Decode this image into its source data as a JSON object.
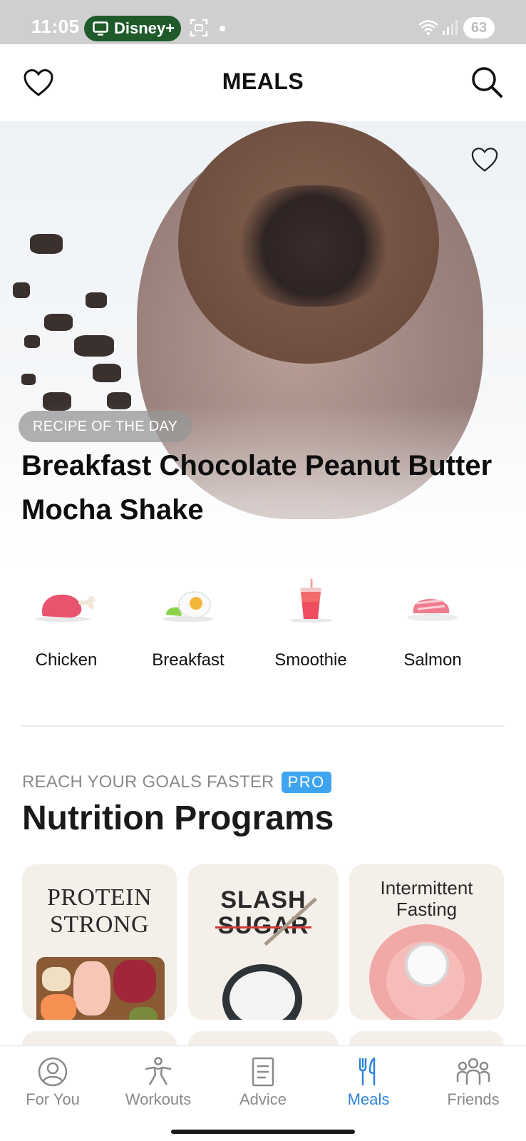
{
  "status_bar": {
    "time": "11:05",
    "app_pill": "Disney+",
    "battery": "63"
  },
  "header": {
    "title": "MEALS"
  },
  "hero": {
    "badge": "RECIPE OF THE DAY",
    "title": "Breakfast Chocolate Peanut Butter Mocha Shake"
  },
  "categories": [
    {
      "label": "Chicken",
      "icon": "chicken-icon"
    },
    {
      "label": "Breakfast",
      "icon": "egg-icon"
    },
    {
      "label": "Smoothie",
      "icon": "smoothie-icon"
    },
    {
      "label": "Salmon",
      "icon": "salmon-icon"
    }
  ],
  "programs": {
    "kicker": "REACH YOUR GOALS FASTER",
    "pro_badge": "PRO",
    "title": "Nutrition Programs",
    "cards": [
      {
        "line1": "PROTEIN",
        "line2": "STRONG"
      },
      {
        "line1": "SLASH",
        "line2": "SUGAR"
      },
      {
        "line1": "Intermittent",
        "line2": "Fasting"
      }
    ]
  },
  "bottom_nav": [
    {
      "label": "For You",
      "icon": "person-icon",
      "active": false
    },
    {
      "label": "Workouts",
      "icon": "workout-icon",
      "active": false
    },
    {
      "label": "Advice",
      "icon": "document-icon",
      "active": false
    },
    {
      "label": "Meals",
      "icon": "utensils-icon",
      "active": true
    },
    {
      "label": "Friends",
      "icon": "friends-icon",
      "active": false
    }
  ],
  "colors": {
    "accent": "#2f84d8",
    "pro_badge": "#3fa4f0",
    "status_pill": "#1e5a2a",
    "card_bg": "#f5efe9"
  }
}
